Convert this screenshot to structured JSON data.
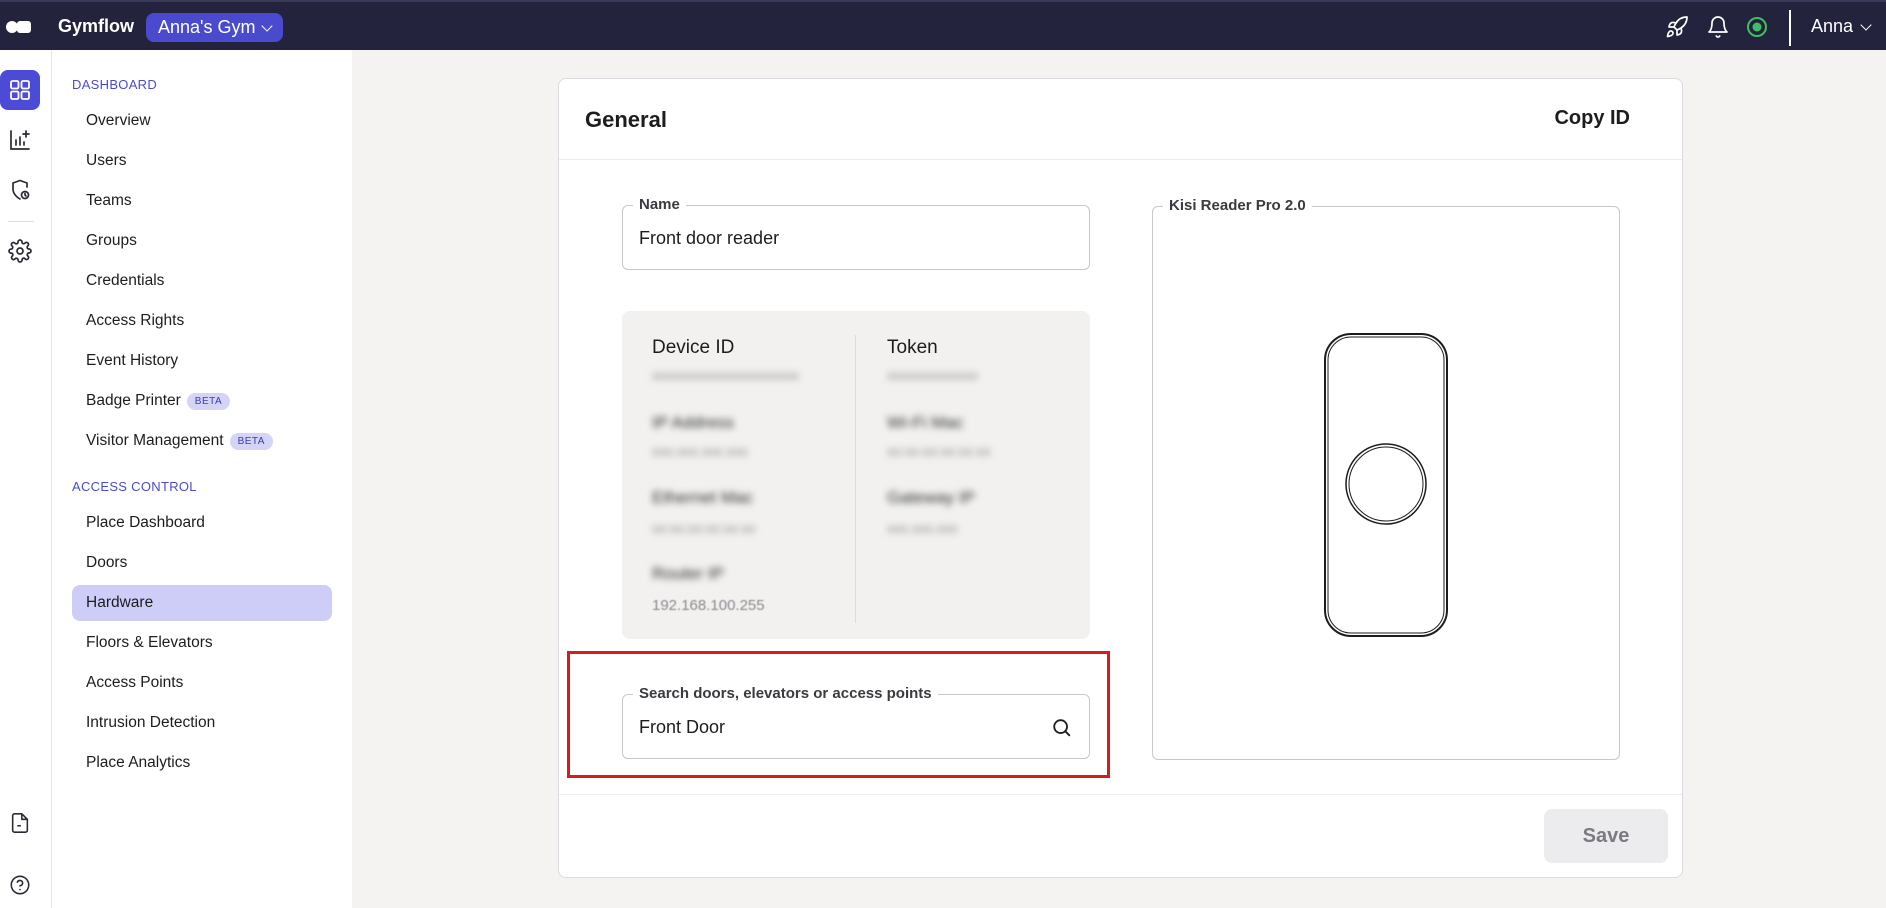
{
  "topbar": {
    "brand": "Gymflow",
    "gym_selector": "Anna's Gym",
    "user_name": "Anna",
    "icons": [
      "rocket-icon",
      "bell-icon",
      "status-online-icon"
    ]
  },
  "rail": {
    "icons": [
      "dashboard-grid-icon",
      "analytics-icon",
      "shield-settings-icon",
      "gear-icon",
      "document-icon",
      "help-icon"
    ]
  },
  "sidebar": {
    "dashboard_section": "DASHBOARD",
    "dashboard_items": [
      {
        "label": "Overview"
      },
      {
        "label": "Users"
      },
      {
        "label": "Teams"
      },
      {
        "label": "Groups"
      },
      {
        "label": "Credentials"
      },
      {
        "label": "Access Rights"
      },
      {
        "label": "Event History"
      },
      {
        "label": "Badge Printer",
        "badge": "BETA"
      },
      {
        "label": "Visitor Management",
        "badge": "BETA"
      }
    ],
    "access_section": "ACCESS CONTROL",
    "access_items": [
      {
        "label": "Place Dashboard"
      },
      {
        "label": "Doors"
      },
      {
        "label": "Hardware",
        "active": true
      },
      {
        "label": "Floors & Elevators"
      },
      {
        "label": "Access Points"
      },
      {
        "label": "Intrusion Detection"
      },
      {
        "label": "Place Analytics"
      }
    ]
  },
  "card": {
    "title": "General",
    "copy_id": "Copy ID",
    "name_field": {
      "label": "Name",
      "value": "Front door reader"
    },
    "info": {
      "device_id_title": "Device ID",
      "token_title": "Token",
      "blurred_left": [
        "IP Address",
        "Ethernet Mac",
        "Router IP"
      ],
      "blurred_right": [
        "Wi-Fi Mac",
        "Gateway IP"
      ],
      "router_ip_value": "192.168.100.255"
    },
    "search_field": {
      "label": "Search doors, elevators or access points",
      "value": "Front Door"
    },
    "device_panel": {
      "label": "Kisi Reader Pro 2.0"
    },
    "save": "Save"
  },
  "colors": {
    "topbar": "#23233d",
    "accent": "#4b4bd8",
    "active_nav": "#cdcdf8",
    "highlight": "#d71c1c"
  }
}
